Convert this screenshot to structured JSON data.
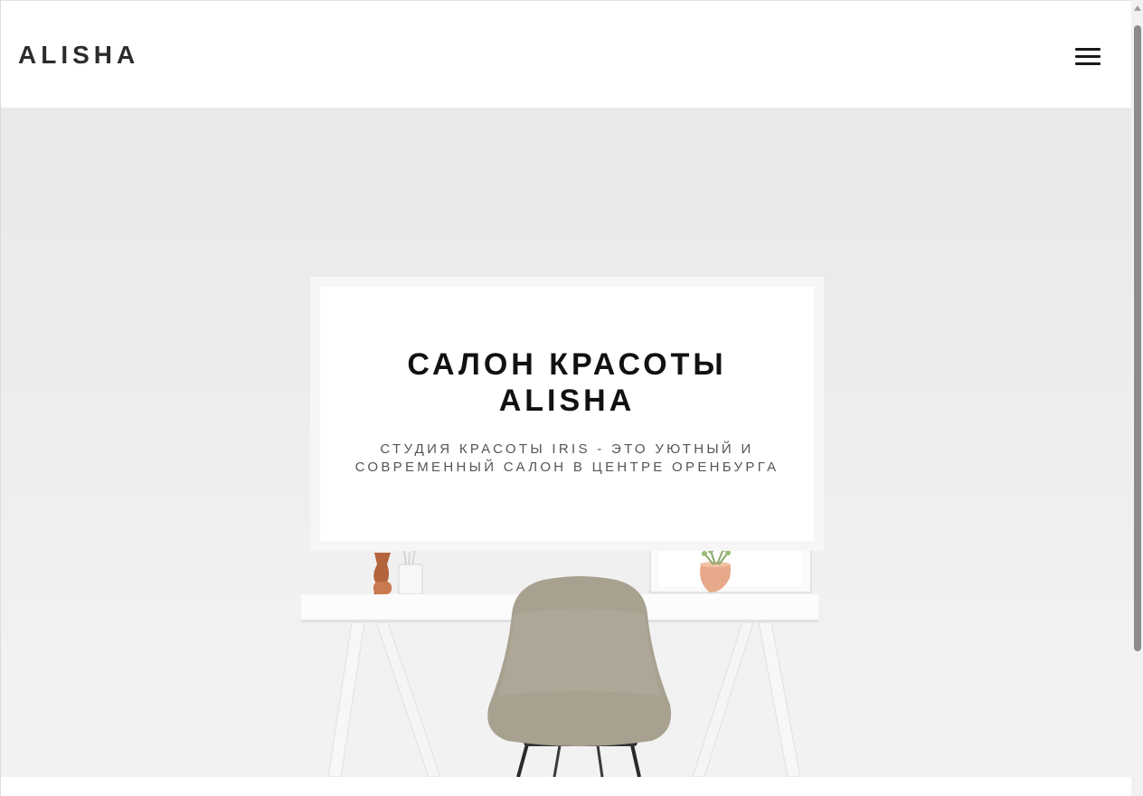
{
  "header": {
    "logo": "ALISHA",
    "menu_icon": "hamburger-menu-icon"
  },
  "hero": {
    "title": "САЛОН КРАСОТЫ ALISHA",
    "subtitle": "СТУДИЯ КРАСОТЫ IRIS - ЭТО УЮТНЫЙ И СОВРЕМЕННЫЙ САЛОН В ЦЕНТРЕ ОРЕНБУРГА",
    "background_image": "white-desk-with-chair-photo"
  },
  "colors": {
    "text_dark": "#2c2c2c",
    "hero_bg": "#ededed",
    "card_bg": "#ffffff"
  }
}
